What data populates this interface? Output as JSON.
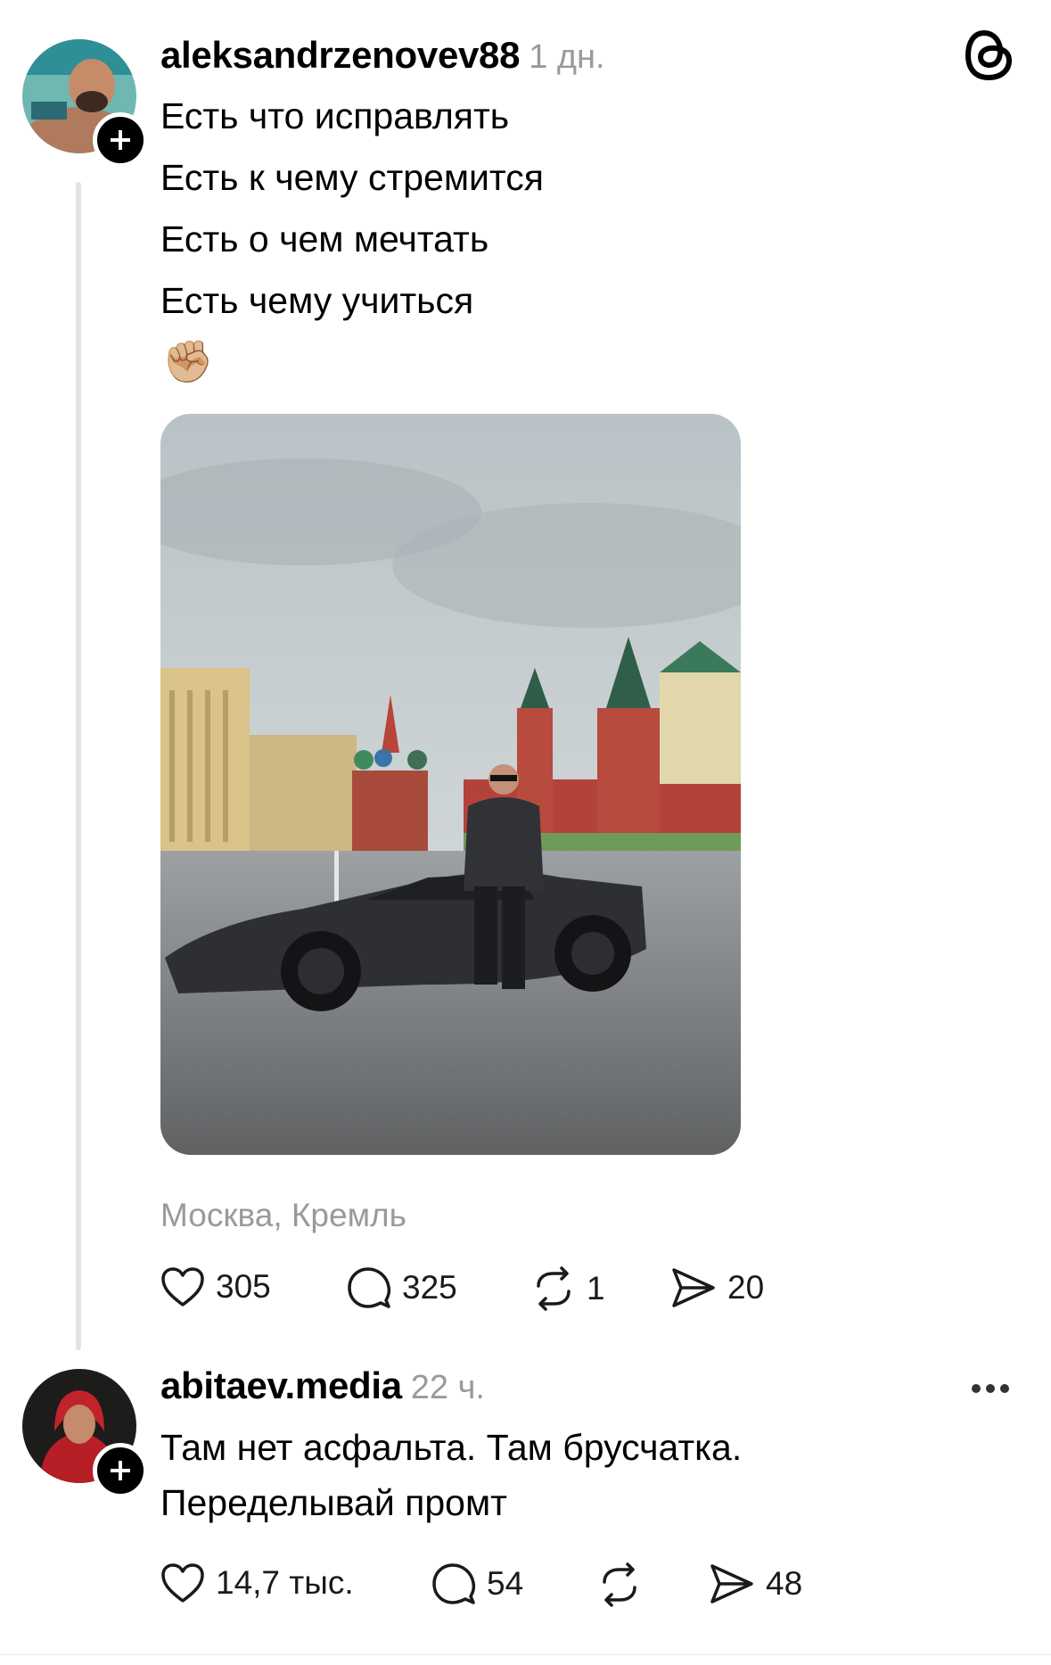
{
  "post": {
    "username": "aleksandrzenovev88",
    "time": "1 дн.",
    "lines": [
      "Есть что исправлять",
      "Есть к чему стремится",
      "Есть о чем мечтать",
      "Есть чему учиться"
    ],
    "emoji": "✊🏼",
    "location": "Москва, Кремль",
    "likes": "305",
    "replies": "325",
    "reposts": "1",
    "shares": "20"
  },
  "reply": {
    "username": "abitaev.media",
    "time": "22 ч.",
    "lines": [
      "Там нет асфальта. Там брусчатка.",
      "Переделывай промт"
    ],
    "likes": "14,7 тыс.",
    "replies": "54",
    "shares": "48"
  },
  "icons": {
    "app": "threads-logo-icon",
    "follow": "plus-icon",
    "like": "heart-icon",
    "reply": "comment-bubble-icon",
    "repost": "repost-icon",
    "share": "send-icon",
    "more": "more-dots-icon"
  },
  "colors": {
    "text": "#000000",
    "muted": "#9a9a9a",
    "thread_line": "#e3e3e3"
  }
}
